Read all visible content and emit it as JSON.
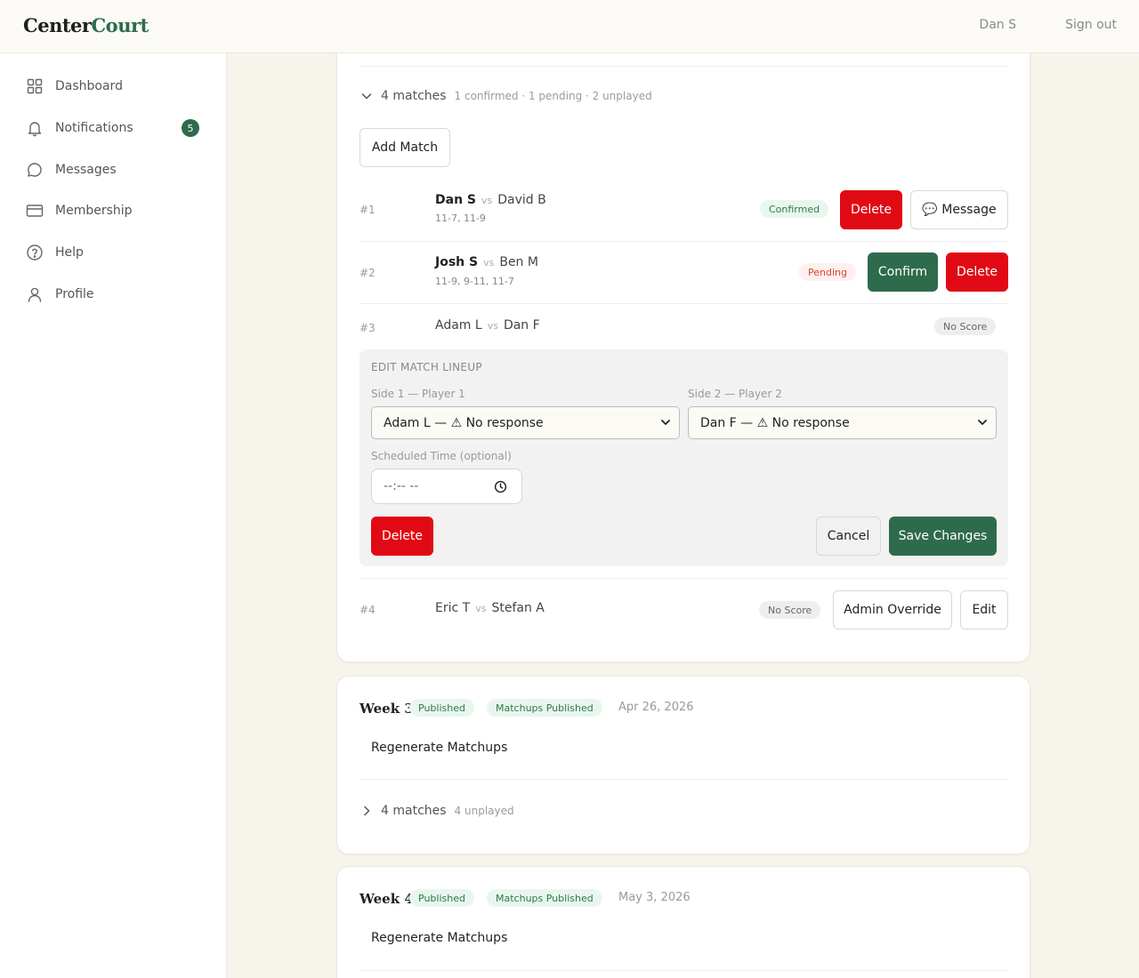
{
  "topbar": {
    "logo_main": "Center",
    "logo_accent": "Court",
    "user": "Dan S",
    "signout": "Sign out"
  },
  "sidebar": {
    "items": [
      {
        "label": "Dashboard",
        "icon": "grid-icon"
      },
      {
        "label": "Notifications",
        "icon": "bell-icon",
        "badge": "5"
      },
      {
        "label": "Messages",
        "icon": "chat-bubble-icon"
      },
      {
        "label": "Membership",
        "icon": "credit-card-icon"
      },
      {
        "label": "Help",
        "icon": "help-circle-icon"
      },
      {
        "label": "Profile",
        "icon": "user-icon"
      }
    ]
  },
  "week2": {
    "matches_count": "4 matches",
    "summary": "1 confirmed · 1 pending · 2 unplayed",
    "add_match": "Add Match",
    "matches": [
      {
        "num": "#1",
        "p1": "Dan S",
        "p2": "David B",
        "score": "11-7, 11-9",
        "status": "Confirmed",
        "delete": "Delete",
        "message": "💬 Message"
      },
      {
        "num": "#2",
        "p1": "Josh S",
        "p2": "Ben M",
        "score": "11-9, 9-11, 11-7",
        "status": "Pending",
        "confirm": "Confirm",
        "delete": "Delete"
      },
      {
        "num": "#3",
        "p1": "Adam L",
        "p2": "Dan F",
        "status": "No Score"
      },
      {
        "num": "#4",
        "p1": "Eric T",
        "p2": "Stefan A",
        "status": "No Score",
        "override": "Admin Override",
        "edit": "Edit"
      }
    ],
    "vs": "vs",
    "edit": {
      "title": "EDIT MATCH LINEUP",
      "side1_label": "Side 1 — Player 1",
      "side1_value": "Adam L — ⚠ No response",
      "side2_label": "Side 2 — Player 2",
      "side2_value": "Dan F — ⚠ No response",
      "time_label": "Scheduled Time (optional)",
      "time_placeholder": "--:-- --",
      "delete": "Delete",
      "cancel": "Cancel",
      "save": "Save Changes"
    }
  },
  "week3": {
    "title": "Week 3",
    "badge1": "Published",
    "badge2": "Matchups Published",
    "date": "Apr 26, 2026",
    "regenerate": "Regenerate Matchups",
    "matches_count": "4 matches",
    "summary": "4 unplayed"
  },
  "week4": {
    "title": "Week 4",
    "badge1": "Published",
    "badge2": "Matchups Published",
    "date": "May 3, 2026",
    "regenerate": "Regenerate Matchups"
  },
  "colors": {
    "brand_green": "#2e6b4c",
    "danger_red": "#e10a14",
    "background": "#f7f4ec"
  }
}
